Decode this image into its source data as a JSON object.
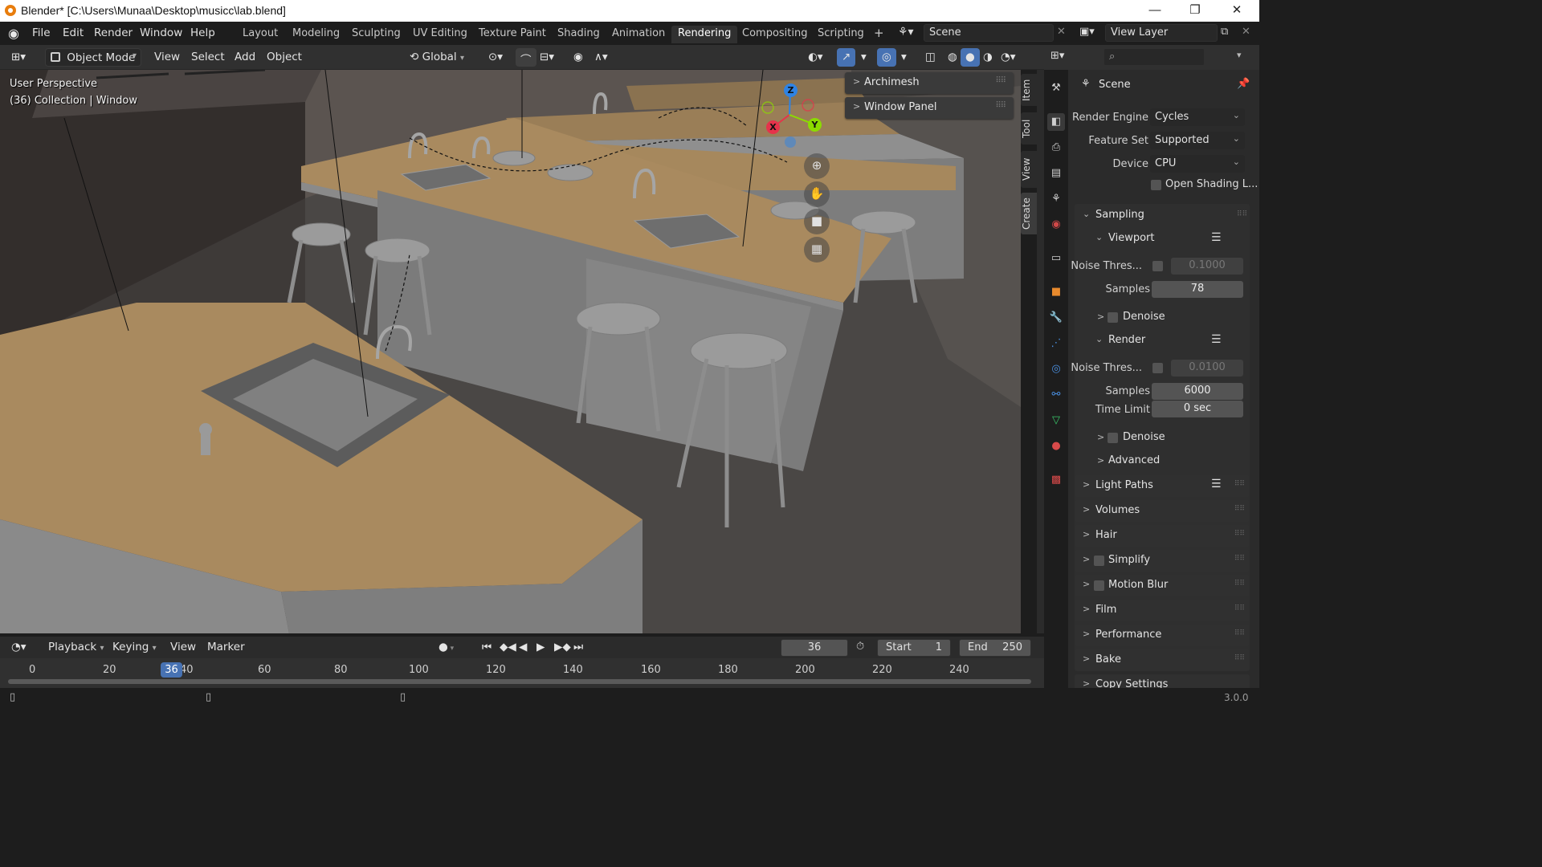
{
  "window": {
    "title": "Blender* [C:\\Users\\Munaa\\Desktop\\musicc\\lab.blend]",
    "minimize": "—",
    "maximize": "❐",
    "close": "✕"
  },
  "menu": [
    "File",
    "Edit",
    "Render",
    "Window",
    "Help"
  ],
  "workspaces": [
    "Layout",
    "Modeling",
    "Sculpting",
    "UV Editing",
    "Texture Paint",
    "Shading",
    "Animation",
    "Rendering",
    "Compositing",
    "Scripting"
  ],
  "active_workspace": "Rendering",
  "add_workspace": "+",
  "scene_field": "Scene",
  "view_layer_field": "View Layer",
  "viewport_header": {
    "mode": "Object Mode",
    "menus": [
      "View",
      "Select",
      "Add",
      "Object"
    ],
    "transform_orientation": "Global"
  },
  "viewport": {
    "perspective_label": "User Perspective",
    "collection_label": "(36) Collection | Window",
    "gizmo_axes": [
      "X",
      "Y",
      "Z"
    ]
  },
  "n_panel": {
    "panels": [
      "Archimesh",
      "Window Panel"
    ],
    "tabs": [
      "Item",
      "Tool",
      "View",
      "Create"
    ]
  },
  "properties": {
    "search_placeholder": "",
    "context": "Scene",
    "render_engine_label": "Render Engine",
    "render_engine": "Cycles",
    "feature_set_label": "Feature Set",
    "feature_set": "Supported",
    "device_label": "Device",
    "device": "CPU",
    "open_shading": "Open Shading L...",
    "sampling": "Sampling",
    "viewport": "Viewport",
    "noise_label": "Noise Thres...",
    "viewport_noise": "0.1000",
    "samples_label": "Samples",
    "viewport_samples": "78",
    "denoise": "Denoise",
    "render": "Render",
    "render_noise": "0.0100",
    "render_samples": "6000",
    "time_limit_label": "Time Limit",
    "time_limit": "0 sec",
    "advanced": "Advanced",
    "sections": [
      "Light Paths",
      "Volumes",
      "Hair",
      "Simplify",
      "Motion Blur",
      "Film",
      "Performance",
      "Bake",
      "Copy Settings"
    ]
  },
  "timeline": {
    "menus": [
      "Playback",
      "Keying",
      "View",
      "Marker"
    ],
    "current_frame": "36",
    "start_label": "Start",
    "start": "1",
    "end_label": "End",
    "end": "250",
    "ticks": [
      "0",
      "20",
      "40",
      "60",
      "80",
      "100",
      "120",
      "140",
      "160",
      "180",
      "200",
      "220",
      "240"
    ],
    "playhead": "36"
  },
  "status": {
    "version": "3.0.0"
  },
  "colors": {
    "accent_blue": "#4772b3",
    "active_orange": "#e87d0d",
    "axis_x": "#e5334b",
    "axis_y": "#8bdc00",
    "axis_z": "#2f83e3"
  }
}
